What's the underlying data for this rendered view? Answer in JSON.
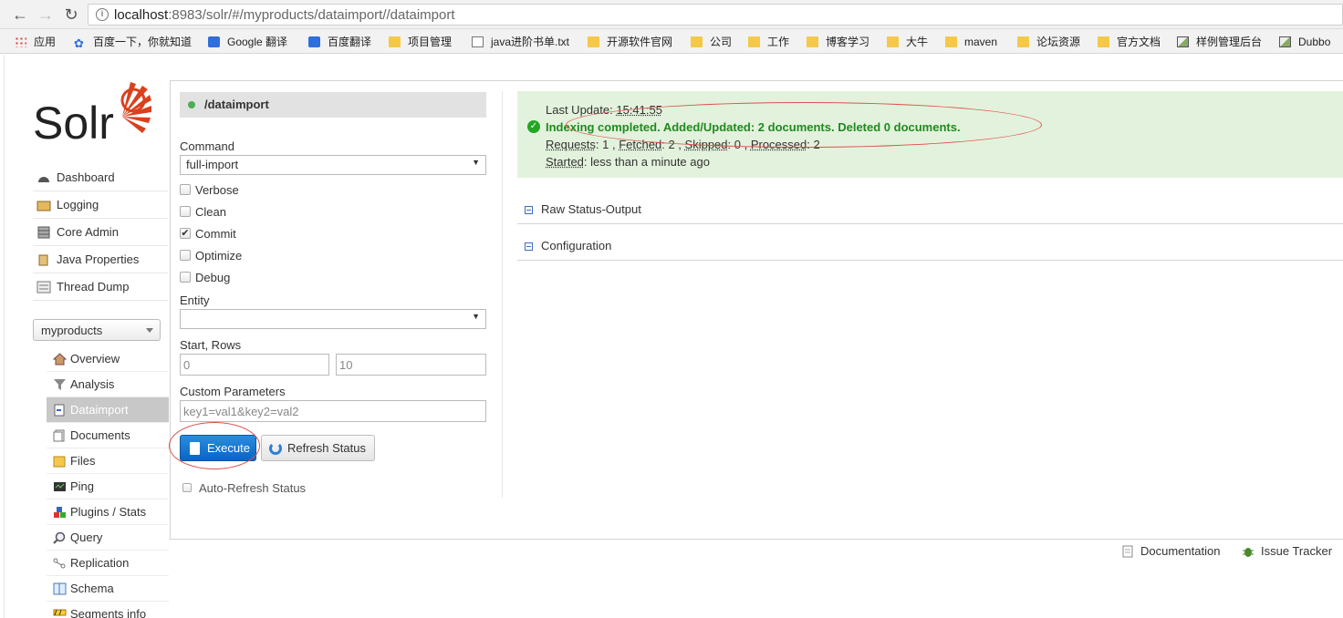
{
  "browser": {
    "url_host": "localhost",
    "url_rest": ":8983/solr/#/myproducts/dataimport//dataimport",
    "bookmarks": [
      {
        "label": "应用",
        "icon": "apps-grid-icon"
      },
      {
        "label": "百度一下，你就知道",
        "icon": "baidu-paw-icon"
      },
      {
        "label": "Google 翻译",
        "icon": "google-translate-icon"
      },
      {
        "label": "百度翻译",
        "icon": "baidu-translate-icon"
      },
      {
        "label": "项目管理",
        "icon": "folder-icon"
      },
      {
        "label": "java进阶书单.txt",
        "icon": "document-icon"
      },
      {
        "label": "开源软件官网",
        "icon": "folder-icon"
      },
      {
        "label": "公司",
        "icon": "folder-icon"
      },
      {
        "label": "工作",
        "icon": "folder-icon"
      },
      {
        "label": "博客学习",
        "icon": "folder-icon"
      },
      {
        "label": "大牛",
        "icon": "folder-icon"
      },
      {
        "label": "maven",
        "icon": "folder-icon"
      },
      {
        "label": "论坛资源",
        "icon": "folder-icon"
      },
      {
        "label": "官方文档",
        "icon": "folder-icon"
      },
      {
        "label": "样例管理后台",
        "icon": "image-icon"
      },
      {
        "label": "Dubbo",
        "icon": "image-icon"
      }
    ]
  },
  "sidebar": {
    "logo_text": "Solr",
    "menu": [
      "Dashboard",
      "Logging",
      "Core Admin",
      "Java Properties",
      "Thread Dump"
    ],
    "core_selector": "myproducts",
    "core_menu": [
      "Overview",
      "Analysis",
      "Dataimport",
      "Documents",
      "Files",
      "Ping",
      "Plugins / Stats",
      "Query",
      "Replication",
      "Schema",
      "Segments info"
    ]
  },
  "form": {
    "handler": "/dataimport",
    "command_label": "Command",
    "command_value": "full-import",
    "options": [
      {
        "label": "Verbose",
        "checked": false
      },
      {
        "label": "Clean",
        "checked": false
      },
      {
        "label": "Commit",
        "checked": true
      },
      {
        "label": "Optimize",
        "checked": false
      },
      {
        "label": "Debug",
        "checked": false
      }
    ],
    "entity_label": "Entity",
    "entity_value": "",
    "start_rows_label": "Start, Rows",
    "start_value": "0",
    "rows_value": "10",
    "custom_params_label": "Custom Parameters",
    "custom_params_value": "key1=val1&key2=val2",
    "execute_label": "Execute",
    "refresh_label": "Refresh Status",
    "auto_refresh_label": "Auto-Refresh Status"
  },
  "status": {
    "last_update_label": "Last Update",
    "last_update_time": "15:41:55",
    "message": "Indexing completed. Added/Updated: 2 documents. Deleted 0 documents.",
    "requests_label": "Requests",
    "requests": "1",
    "fetched_label": "Fetched",
    "fetched": "2",
    "skipped_label": "Skipped",
    "skipped": "0",
    "processed_label": "Processed",
    "processed": "2",
    "started_label": "Started",
    "started_value": "less than a minute ago"
  },
  "sections": [
    "Raw Status-Output",
    "Configuration"
  ],
  "footer": {
    "documentation": "Documentation",
    "issue_tracker": "Issue Tracker"
  },
  "colors": {
    "accent_blue": "#0a64c2",
    "success_green": "#1f8a1f",
    "status_bg": "#e3f2dc",
    "annotation_red": "#d9534f",
    "solr_orange": "#d9411e"
  }
}
